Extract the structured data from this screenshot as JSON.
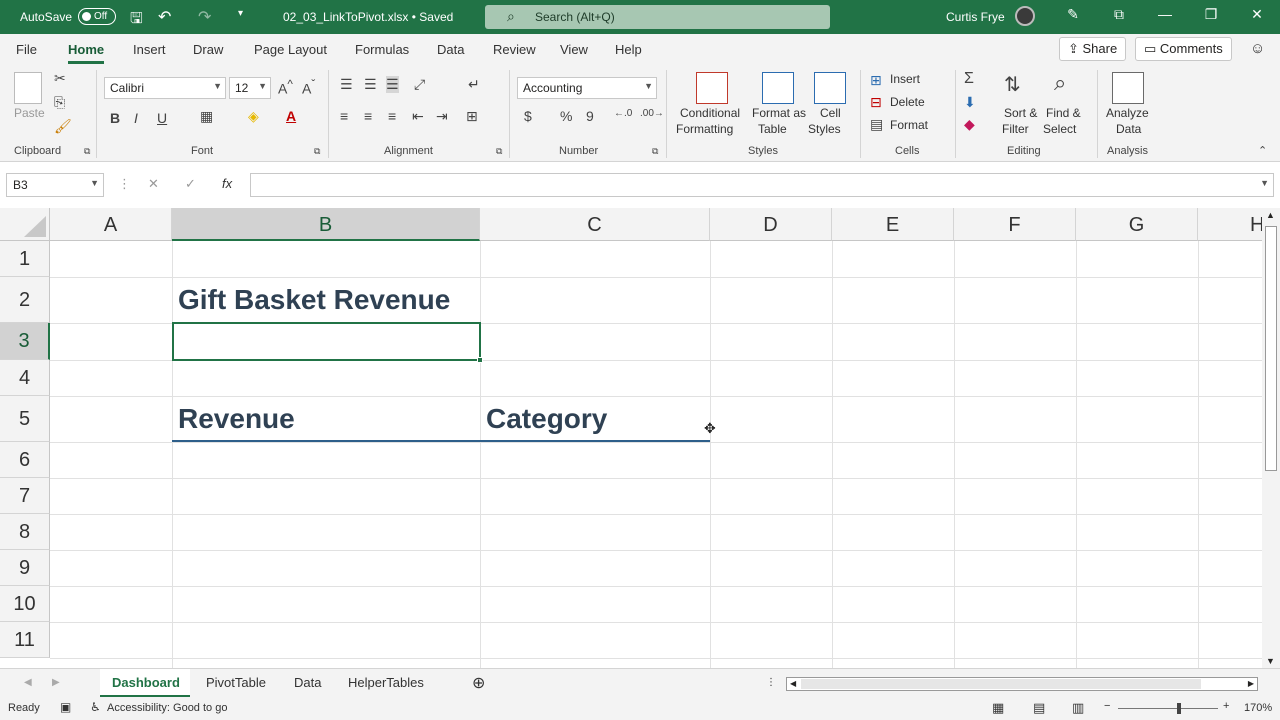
{
  "titlebar": {
    "autosave_label": "AutoSave",
    "autosave_state": "Off",
    "filename": "02_03_LinkToPivot.xlsx • Saved",
    "search_placeholder": "Search (Alt+Q)",
    "user_name": "Curtis Frye"
  },
  "tabs": [
    "File",
    "Home",
    "Insert",
    "Draw",
    "Page Layout",
    "Formulas",
    "Data",
    "Review",
    "View",
    "Help"
  ],
  "share_label": "Share",
  "comments_label": "Comments",
  "ribbon": {
    "paste_label": "Paste",
    "clipboard_label": "Clipboard",
    "font_name": "Calibri",
    "font_size": "12",
    "font_label": "Font",
    "alignment_label": "Alignment",
    "number_format": "Accounting",
    "number_label": "Number",
    "conditional_formatting": "Conditional",
    "conditional_formatting_2": "Formatting",
    "format_as_table": "Format as",
    "format_as_table_2": "Table",
    "cell_styles": "Cell",
    "cell_styles_2": "Styles",
    "styles_label": "Styles",
    "insert_label": "Insert",
    "delete_label": "Delete",
    "format_label": "Format",
    "cells_label": "Cells",
    "sort_filter": "Sort &",
    "sort_filter_2": "Filter",
    "find_select": "Find &",
    "find_select_2": "Select",
    "editing_label": "Editing",
    "analyze_data": "Analyze",
    "analyze_data_2": "Data",
    "analysis_label": "Analysis"
  },
  "formula_bar": {
    "name_box": "B3",
    "formula": ""
  },
  "grid": {
    "columns": [
      "A",
      "B",
      "C",
      "D",
      "E",
      "F",
      "G",
      "H"
    ],
    "rows": [
      "1",
      "2",
      "3",
      "4",
      "5",
      "6",
      "7",
      "8",
      "9",
      "10",
      "11"
    ],
    "b2": "Gift Basket Revenue",
    "b5": "Revenue",
    "c5": "Category"
  },
  "sheets": [
    "Dashboard",
    "PivotTable",
    "Data",
    "HelperTables"
  ],
  "status": {
    "ready": "Ready",
    "accessibility": "Accessibility: Good to go",
    "zoom": "170%"
  }
}
